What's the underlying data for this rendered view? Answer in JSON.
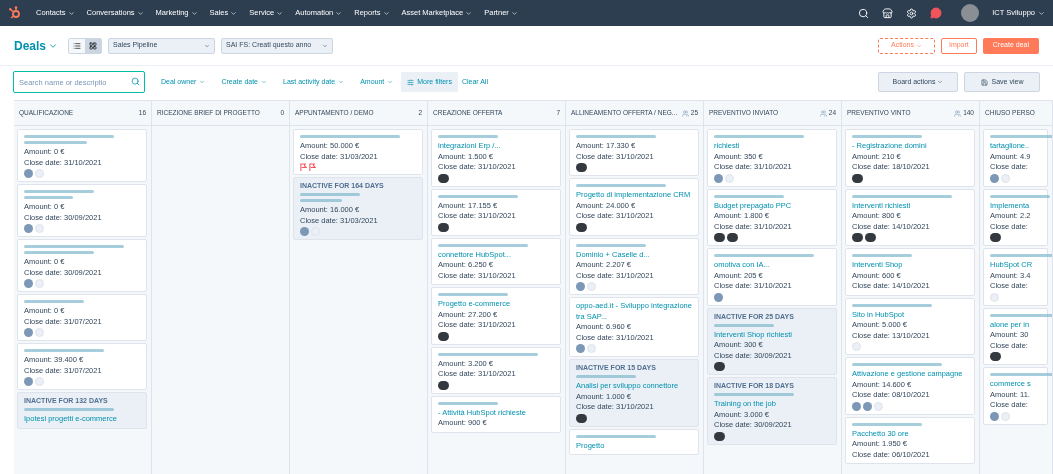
{
  "nav": {
    "items": [
      "Contacts",
      "Conversations",
      "Marketing",
      "Sales",
      "Service",
      "Automation",
      "Reports",
      "Asset Marketplace",
      "Partner"
    ],
    "user": "ICT Sviluppo"
  },
  "header": {
    "title": "Deals",
    "views": [
      {
        "kind": "list",
        "selected": false
      },
      {
        "kind": "board",
        "selected": true
      }
    ],
    "selects": [
      "Sales Pipeline",
      "SAI FS: Creati questo anno"
    ],
    "actions": "Actions",
    "import": "Import",
    "create": "Create deal"
  },
  "filters": {
    "search_placeholder": "Search name or descriptio",
    "dropdowns": [
      "Deal owner",
      "Create date",
      "Last activity date",
      "Amount"
    ],
    "more": "More filters",
    "clear": "Clear All",
    "board_actions": "Board actions",
    "save_view": "Save view"
  },
  "columns": [
    {
      "title": "QUALIFICAZIONE",
      "count": "16",
      "people": false,
      "cards": [
        {
          "kind": "two_line_scribble",
          "amount": "Amount: 0 €",
          "close": "Close date: 31/10/2021",
          "avatars": [
            {
              "kind": "initials"
            },
            {
              "kind": "blank"
            }
          ]
        },
        {
          "kind": "two_line_scribble",
          "amount": "Amount: 0 €",
          "close": "Close date: 30/09/2021",
          "avatars": [
            {
              "kind": "initials"
            },
            {
              "kind": "blank"
            }
          ]
        },
        {
          "kind": "two_line_scribble",
          "amount": "Amount: 0 €",
          "close": "Close date: 30/09/2021",
          "avatars": [
            {
              "kind": "initials"
            },
            {
              "kind": "blank"
            }
          ]
        },
        {
          "kind": "one_line_scribble",
          "amount": "Amount: 0 €",
          "close": "Close date: 31/07/2021",
          "avatars": [
            {
              "kind": "initials"
            },
            {
              "kind": "blank"
            }
          ]
        },
        {
          "kind": "one_line_scribble",
          "amount": "Amount: 39.400 €",
          "close": "Close date: 31/07/2021",
          "avatars": [
            {
              "kind": "initials"
            },
            {
              "kind": "blank"
            }
          ]
        },
        {
          "kind": "one_line_scribble",
          "inactive": "INACTIVE FOR 132 DAYS",
          "title": "Ipotesi progetti e-commerce"
        }
      ]
    },
    {
      "title": "RICEZIONE BRIEF DI PROGETTO",
      "count": "0",
      "people": false
    },
    {
      "title": "APPUNTAMENTO / DEMO",
      "count": "2",
      "people": false,
      "cards": [
        {
          "kind": "one_line_scribble",
          "amount": "Amount: 50.000 €",
          "close": "Close date: 31/03/2021",
          "avatars": [
            {
              "kind": "flag"
            },
            {
              "kind": "flag"
            }
          ]
        },
        {
          "kind": "two_line_scribble",
          "inactive": "INACTIVE FOR 164 DAYS",
          "amount": "Amount: 16.000 €",
          "close": "Close date: 31/03/2021",
          "avatars": [
            {
              "kind": "initials"
            },
            {
              "kind": "blank"
            }
          ]
        }
      ]
    },
    {
      "title": "CREAZIONE OFFERTA",
      "count": "7",
      "people": false,
      "cards": [
        {
          "kind": "one_line_scribble",
          "title": "integrazioni Erp /...",
          "amount": "Amount: 1.500 €",
          "close": "Close date: 31/10/2021",
          "avatars": [
            {
              "kind": "photo"
            }
          ]
        },
        {
          "kind": "one_line_scribble",
          "amount": "Amount: 17.155 €",
          "close": "Close date: 31/10/2021",
          "avatars": [
            {
              "kind": "photo"
            }
          ]
        },
        {
          "kind": "one_line_scribble",
          "title": "connettore HubSpot...",
          "amount": "Amount: 6.250 €",
          "close": "Close date: 31/10/2021"
        },
        {
          "kind": "one_line_scribble",
          "title": "Progetto e-commerce",
          "amount": "Amount: 27.200 €",
          "close": "Close date: 31/10/2021",
          "avatars": [
            {
              "kind": "photo"
            }
          ]
        },
        {
          "kind": "one_line_scribble",
          "amount": "Amount: 3.200 €",
          "close": "Close date: 31/10/2021",
          "avatars": [
            {
              "kind": "photo"
            }
          ]
        },
        {
          "kind": "one_line_scribble",
          "title": "- Attività HubSpot richieste",
          "amount": "Amount: 900 €"
        }
      ]
    },
    {
      "title": "ALLINEAMENTO OFFERTA / NEG...",
      "count": "25",
      "people": true,
      "cards": [
        {
          "kind": "one_line_scribble",
          "amount": "Amount: 17.330 €",
          "close": "Close date: 31/10/2021",
          "avatars": [
            {
              "kind": "photo"
            }
          ]
        },
        {
          "kind": "one_line_scribble",
          "title": "Progetto di implementazione CRM",
          "amount": "Amount: 24.000 €",
          "close": "Close date: 31/10/2021",
          "avatars": [
            {
              "kind": "photo"
            }
          ]
        },
        {
          "kind": "one_line_scribble",
          "title": "Dominio + Caselle d...",
          "amount": "Amount: 2.207 €",
          "close": "Close date: 31/10/2021",
          "avatars": [
            {
              "kind": "initials"
            },
            {
              "kind": "blank"
            }
          ]
        },
        {
          "kind": "plain",
          "title": "oppo-aed.it - Sviluppo integrazione tra SAP...",
          "amount": "Amount: 6.960 €",
          "close": "Close date: 31/10/2021",
          "avatars": [
            {
              "kind": "initials"
            },
            {
              "kind": "blank"
            }
          ]
        },
        {
          "kind": "one_line_scribble",
          "inactive": "INACTIVE FOR 15 DAYS",
          "title": "Analisi per sviluppo connettore",
          "amount": "Amount: 1.000 €",
          "close": "Close date: 31/10/2021",
          "avatars": [
            {
              "kind": "photo"
            }
          ]
        },
        {
          "kind": "one_line_scribble",
          "title": "Progetto"
        }
      ]
    },
    {
      "title": "PREVENTIVO INVIATO",
      "count": "24",
      "people": true,
      "cards": [
        {
          "kind": "one_line_scribble",
          "title": "richiesti",
          "amount": "Amount: 350 €",
          "close": "Close date: 31/10/2021",
          "avatars": [
            {
              "kind": "initials"
            },
            {
              "kind": "blank"
            }
          ]
        },
        {
          "kind": "one_line_scribble",
          "title": "Budget prepagato PPC",
          "amount": "Amount: 1.800 €",
          "close": "Close date: 31/10/2021",
          "avatars": [
            {
              "kind": "photo"
            },
            {
              "kind": "photo"
            }
          ]
        },
        {
          "kind": "one_line_scribble",
          "title": "omotiva con IA...",
          "amount": "Amount: 205 €",
          "close": "Close date: 31/10/2021",
          "avatars": [
            {
              "kind": "initials"
            }
          ]
        },
        {
          "kind": "one_line_scribble",
          "inactive": "INACTIVE FOR 25 DAYS",
          "title": "Interventi Shop richiesti",
          "amount": "Amount: 300 €",
          "close": "Close date: 30/09/2021",
          "avatars": [
            {
              "kind": "photo"
            }
          ]
        },
        {
          "kind": "one_line_scribble",
          "inactive": "INACTIVE FOR 18 DAYS",
          "title": "Training on the job",
          "amount": "Amount: 3.000 €",
          "close": "Close date: 30/09/2021",
          "avatars": [
            {
              "kind": "photo"
            }
          ]
        }
      ]
    },
    {
      "title": "PREVENTIVO VINTO",
      "count": "140",
      "people": true,
      "cards": [
        {
          "kind": "one_line_scribble",
          "title": "- Registrazione domini",
          "amount": "Amount: 210 €",
          "close": "Close date: 18/10/2021",
          "avatars": [
            {
              "kind": "photo"
            }
          ]
        },
        {
          "kind": "one_line_scribble",
          "title": "Interventi richiesti",
          "amount": "Amount: 800 €",
          "close": "Close date: 14/10/2021",
          "avatars": [
            {
              "kind": "photo"
            },
            {
              "kind": "photo"
            }
          ]
        },
        {
          "kind": "one_line_scribble",
          "title": "Interventi Shop",
          "amount": "Amount: 600 €",
          "close": "Close date: 14/10/2021"
        },
        {
          "kind": "one_line_scribble",
          "title": "Sito in HubSpot",
          "amount": "Amount: 5.000 €",
          "close": "Close date: 13/10/2021",
          "avatars": [
            {
              "kind": "blank"
            }
          ]
        },
        {
          "kind": "one_line_scribble",
          "title": "Attivazione e gestione campagne",
          "amount": "Amount: 14.600 €",
          "close": "Close date: 08/10/2021",
          "avatars": [
            {
              "kind": "initials"
            },
            {
              "kind": "initials"
            },
            {
              "kind": "blank"
            }
          ]
        },
        {
          "kind": "one_line_scribble",
          "title": "Pacchetto 30 ore",
          "amount": "Amount: 1.950 €",
          "close": "Close date: 06/10/2021"
        }
      ]
    },
    {
      "title": "CHIUSO PERSO",
      "people": false,
      "cards": [
        {
          "kind": "one_line_scribble",
          "title": "tartaglione..",
          "amount": "Amount: 4.9",
          "close": "Close date:",
          "avatars": [
            {
              "kind": "initials"
            },
            {
              "kind": "blank"
            }
          ]
        },
        {
          "kind": "one_line_scribble",
          "title": "Implementa",
          "amount": "Amount: 2.2",
          "close": "Close date:",
          "avatars": [
            {
              "kind": "photo"
            }
          ]
        },
        {
          "kind": "one_line_scribble",
          "title": "HubSpot CR",
          "amount": "Amount: 3.4",
          "close": "Close date:",
          "avatars": [
            {
              "kind": "blank"
            }
          ]
        },
        {
          "kind": "one_line_scribble",
          "title": "alone per in",
          "amount": "Amount: 30",
          "close": "Close date:",
          "avatars": [
            {
              "kind": "photo"
            }
          ]
        },
        {
          "kind": "one_line_scribble",
          "title": "commerce s",
          "amount": "Amount: 11.",
          "close": "Close date:",
          "avatars": [
            {
              "kind": "initials"
            },
            {
              "kind": "blank"
            }
          ]
        }
      ]
    }
  ]
}
